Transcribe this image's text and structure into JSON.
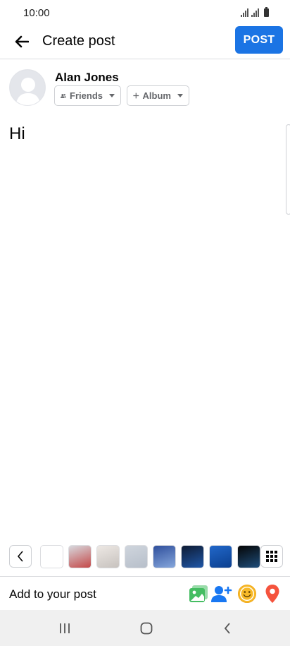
{
  "status_bar": {
    "time": "10:00"
  },
  "header": {
    "title": "Create post",
    "post_label": "POST"
  },
  "composer": {
    "user_name": "Alan Jones",
    "audience_label": "Friends",
    "album_label": "Album",
    "text": "Hi"
  },
  "media_strip": {
    "thumbnails": [
      {
        "name": "thumbnail-blank",
        "colors": [
          "#ffffff",
          "#ffffff"
        ]
      },
      {
        "name": "thumbnail-airplane",
        "colors": [
          "#d7d9de",
          "#c44848"
        ]
      },
      {
        "name": "thumbnail-feathers",
        "colors": [
          "#ede8e4",
          "#c7c2be"
        ]
      },
      {
        "name": "thumbnail-grey",
        "colors": [
          "#cfd5dd",
          "#b7bfca"
        ]
      },
      {
        "name": "thumbnail-surfer",
        "colors": [
          "#2f4f9c",
          "#86a7dc"
        ]
      },
      {
        "name": "thumbnail-waves",
        "colors": [
          "#0e1b33",
          "#1f57a8"
        ]
      },
      {
        "name": "thumbnail-ocean",
        "colors": [
          "#2167c9",
          "#0b3f8f"
        ]
      },
      {
        "name": "thumbnail-dark-circle",
        "colors": [
          "#050505",
          "#1e4d7a"
        ]
      }
    ]
  },
  "add_to_post": {
    "label": "Add to your post",
    "icons": [
      "photo-icon",
      "tag-people-icon",
      "feeling-icon",
      "location-icon"
    ]
  },
  "colors": {
    "accent": "#1b74e4",
    "photo": "#45bd62",
    "tag": "#1877f2",
    "feeling": "#f7b928",
    "location": "#f5533d"
  }
}
